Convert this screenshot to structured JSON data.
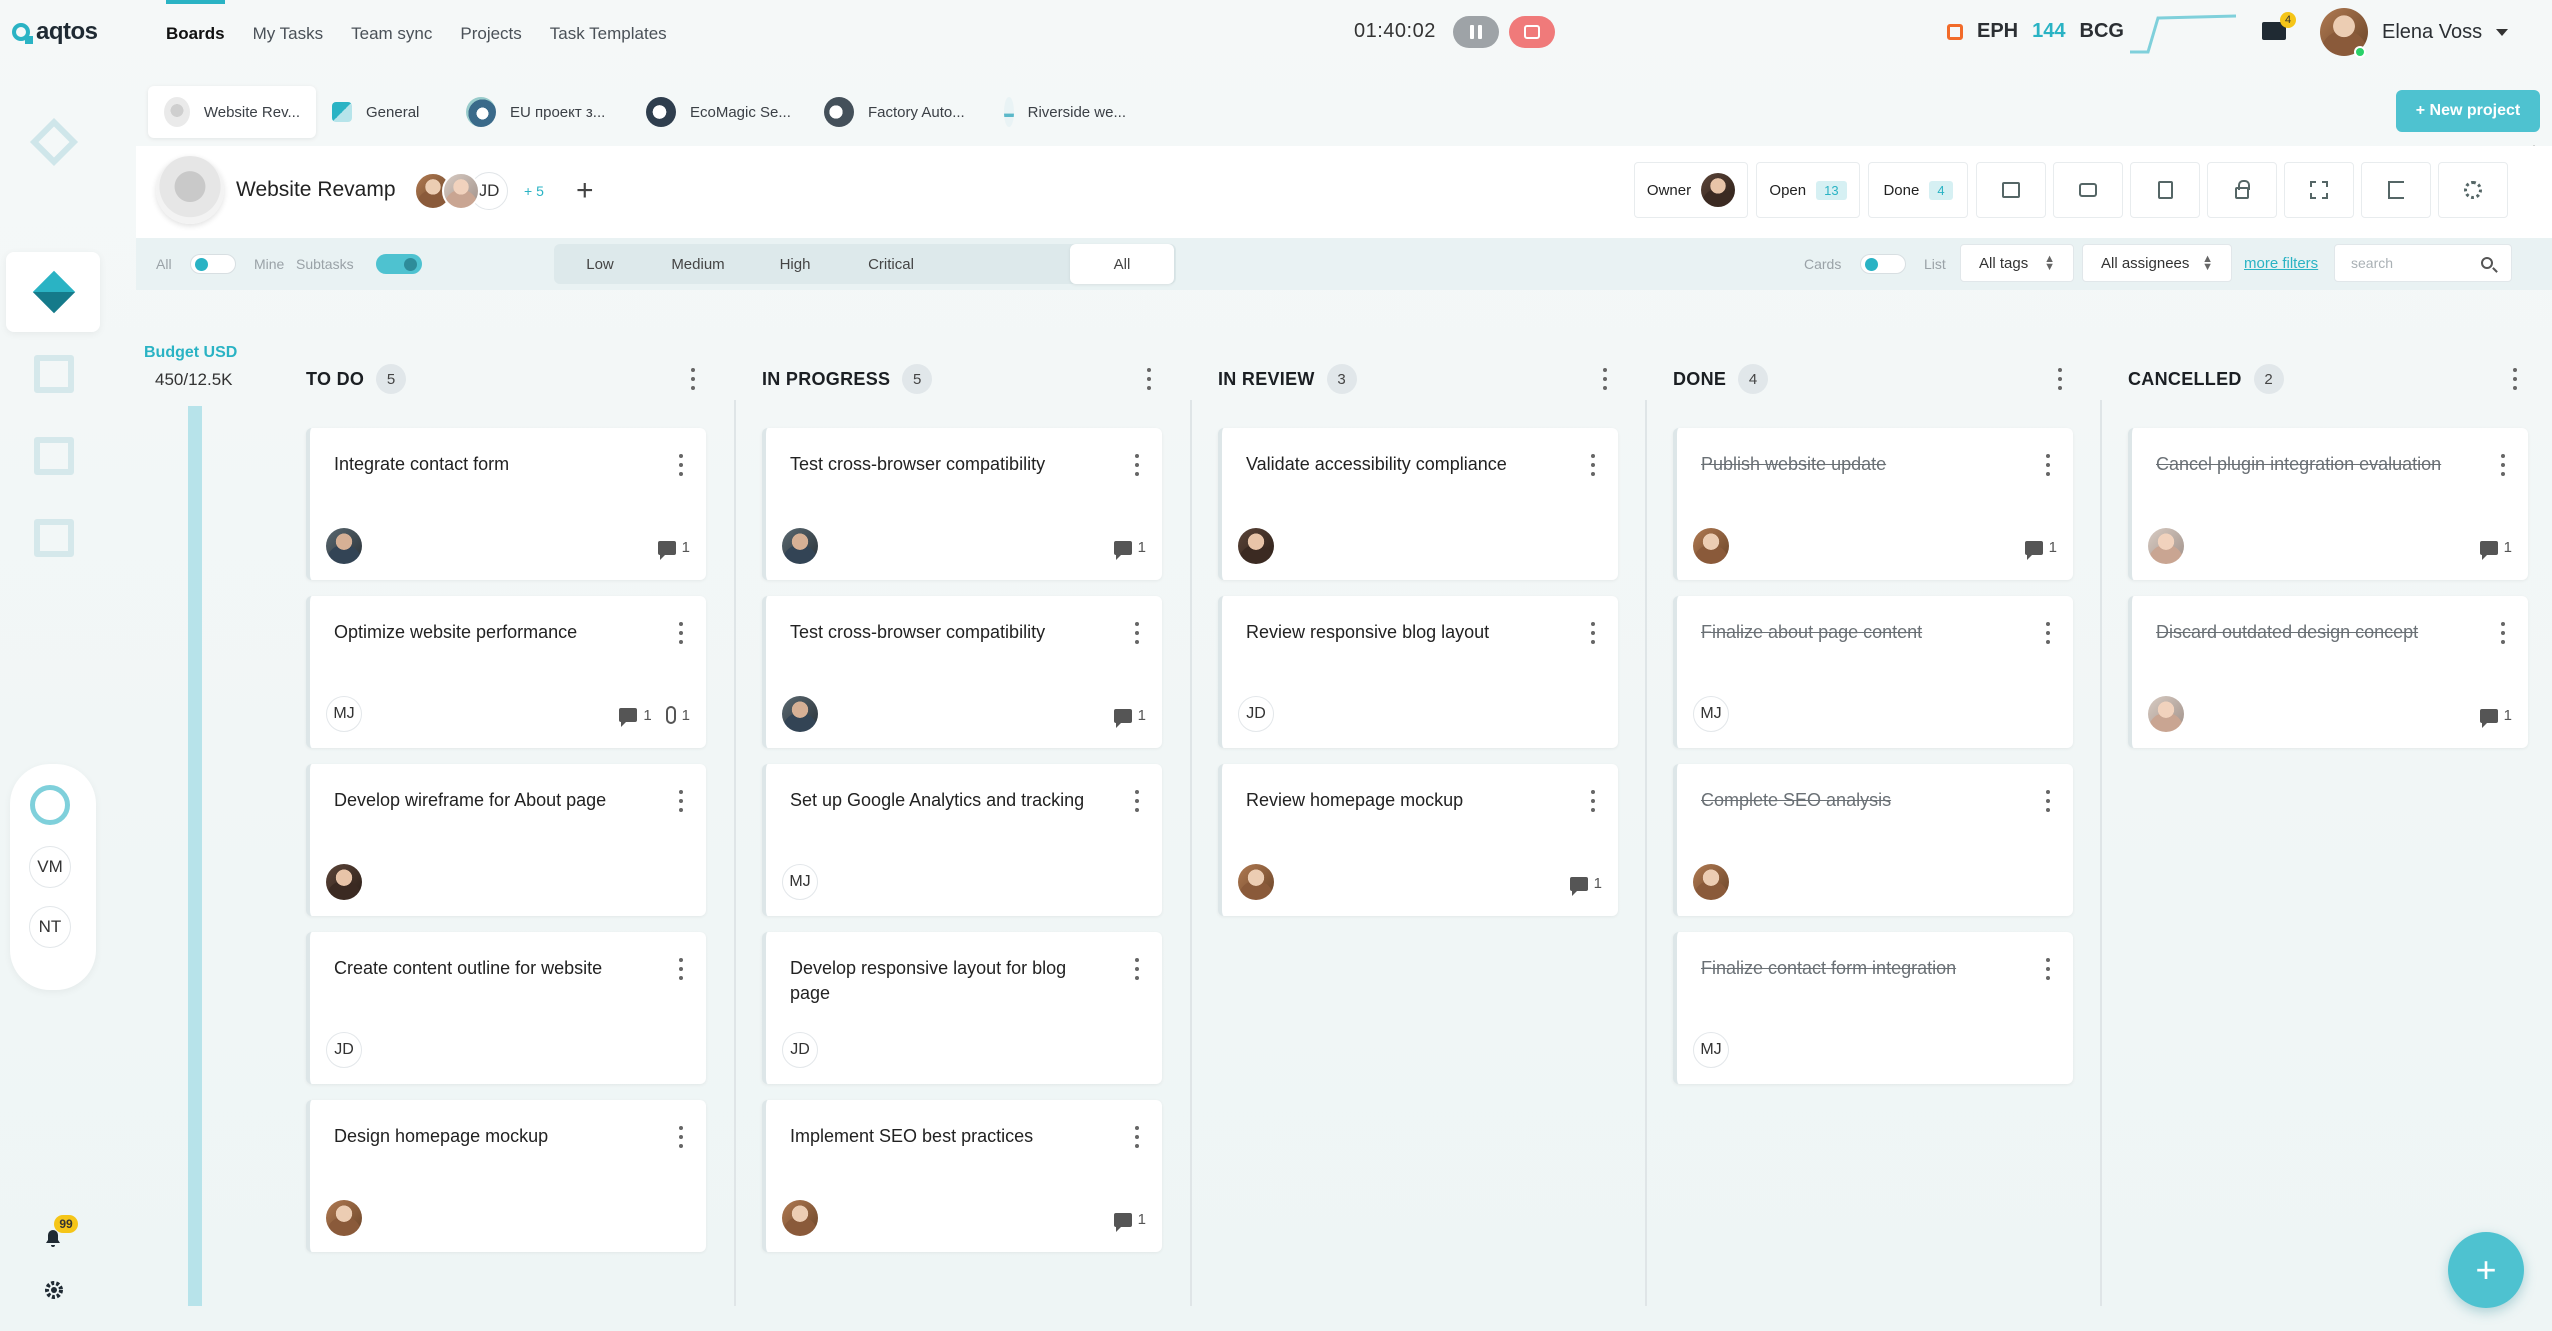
{
  "app": {
    "logo_text": "aqtos"
  },
  "nav": {
    "items": [
      "Boards",
      "My Tasks",
      "Team sync",
      "Projects",
      "Task Templates"
    ],
    "active": "Boards"
  },
  "timer": {
    "value": "01:40:02"
  },
  "company": {
    "code": "EPH",
    "count": "144",
    "name": "BCG"
  },
  "mail": {
    "badge": "4"
  },
  "user": {
    "name": "Elena Voss"
  },
  "project_tabs": [
    {
      "label": "Website Rev..."
    },
    {
      "label": "General"
    },
    {
      "label": "EU проект з..."
    },
    {
      "label": "EcoMagic Se..."
    },
    {
      "label": "Factory Auto..."
    },
    {
      "label": "Riverside we..."
    }
  ],
  "new_project_label": "+ New project",
  "project": {
    "title": "Website Revamp",
    "member_initials": "JD",
    "more_members": "+ 5",
    "owner_label": "Owner",
    "open_label": "Open",
    "open_count": "13",
    "done_label": "Done",
    "done_count": "4"
  },
  "filters": {
    "all_label": "All",
    "mine_label": "Mine",
    "subtasks_label": "Subtasks",
    "priorities": [
      "Low",
      "Medium",
      "High",
      "Critical",
      "All"
    ],
    "active_priority": "All",
    "cards_label": "Cards",
    "list_label": "List",
    "tags_select": "All tags",
    "assignees_select": "All assignees",
    "more_filters": "more filters",
    "search_placeholder": "search"
  },
  "budget": {
    "label": "Budget USD",
    "value": "450/12.5K"
  },
  "rail": {
    "users": [
      "VM",
      "NT"
    ],
    "notifications_badge": "99"
  },
  "columns": [
    {
      "title": "TO DO",
      "count": "5",
      "cards": [
        {
          "title": "Integrate contact form",
          "assignee": "photo-b",
          "comments": "1"
        },
        {
          "title": "Optimize website performance",
          "assignee": "MJ",
          "comments": "1",
          "attachments": "1"
        },
        {
          "title": "Develop wireframe for About page",
          "assignee": "photo-a"
        },
        {
          "title": "Create content outline for website",
          "assignee": "JD"
        },
        {
          "title": "Design homepage mockup",
          "assignee": "photo-c"
        }
      ]
    },
    {
      "title": "IN PROGRESS",
      "count": "5",
      "cards": [
        {
          "title": "Test cross-browser compatibility",
          "assignee": "photo-b",
          "comments": "1"
        },
        {
          "title": "Test cross-browser compatibility",
          "assignee": "photo-b",
          "comments": "1"
        },
        {
          "title": "Set up Google Analytics and tracking",
          "assignee": "MJ"
        },
        {
          "title": "Develop responsive layout for blog page",
          "assignee": "JD"
        },
        {
          "title": "Implement SEO best practices",
          "assignee": "photo-c",
          "comments": "1"
        }
      ]
    },
    {
      "title": "IN REVIEW",
      "count": "3",
      "cards": [
        {
          "title": "Validate accessibility compliance",
          "assignee": "photo-a"
        },
        {
          "title": "Review responsive blog layout",
          "assignee": "JD"
        },
        {
          "title": "Review homepage mockup",
          "assignee": "photo-c",
          "comments": "1"
        }
      ]
    },
    {
      "title": "DONE",
      "count": "4",
      "struck": true,
      "cards": [
        {
          "title": "Publish website update",
          "assignee": "photo-c",
          "comments": "1"
        },
        {
          "title": "Finalize about page content",
          "assignee": "MJ"
        },
        {
          "title": "Complete SEO analysis",
          "assignee": "photo-c"
        },
        {
          "title": "Finalize contact form integration",
          "assignee": "MJ"
        }
      ]
    },
    {
      "title": "CANCELLED",
      "count": "2",
      "struck": true,
      "cards": [
        {
          "title": "Cancel plugin integration evaluation",
          "assignee": "photo-d",
          "comments": "1"
        },
        {
          "title": "Discard outdated design concept",
          "assignee": "photo-d",
          "comments": "1"
        }
      ]
    }
  ],
  "fab_label": "+",
  "colors": {
    "accent": "#2ab3c4",
    "accent_light": "#4ec2d0",
    "stop": "#f07a7a",
    "brand_orange": "#f26b2a"
  }
}
